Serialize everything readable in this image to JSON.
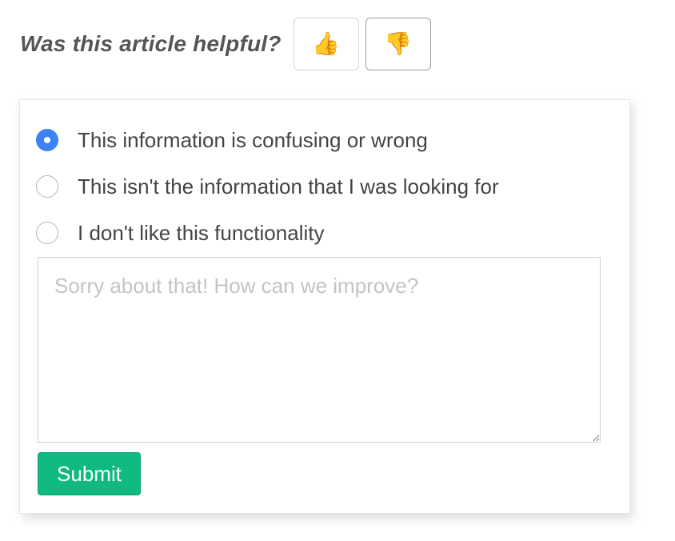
{
  "feedback": {
    "question": "Was this article helpful?",
    "thumbs_up": "👍",
    "thumbs_down": "👎"
  },
  "reasons": {
    "selected_index": 0,
    "options": [
      {
        "label": "This information is confusing or wrong",
        "checked": true
      },
      {
        "label": "This isn't the information that I was looking for",
        "checked": false
      },
      {
        "label": "I don't like this functionality",
        "checked": false
      }
    ]
  },
  "comment": {
    "value": "",
    "placeholder": "Sorry about that! How can we improve?"
  },
  "submit": {
    "label": "Submit"
  },
  "colors": {
    "accent_radio": "#3b82f6",
    "submit_green": "#10b981"
  }
}
